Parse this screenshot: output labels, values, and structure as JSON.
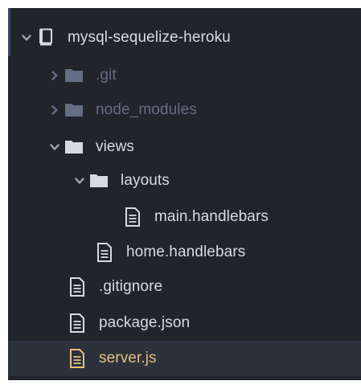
{
  "tree": {
    "root": {
      "label": "mysql-sequelize-heroku",
      "icon": "repo-icon",
      "expanded": true
    },
    "items": [
      {
        "label": ".git",
        "type": "folder",
        "expanded": false,
        "status": "ignored",
        "icon": "folder-icon"
      },
      {
        "label": "node_modules",
        "type": "folder",
        "expanded": false,
        "status": "ignored",
        "icon": "folder-icon"
      },
      {
        "label": "views",
        "type": "folder",
        "expanded": true,
        "status": "normal",
        "icon": "folder-icon"
      },
      {
        "label": "layouts",
        "type": "folder",
        "expanded": true,
        "status": "normal",
        "icon": "folder-icon"
      },
      {
        "label": "main.handlebars",
        "type": "file",
        "status": "normal",
        "icon": "file-text-icon"
      },
      {
        "label": "home.handlebars",
        "type": "file",
        "status": "normal",
        "icon": "file-text-icon"
      },
      {
        "label": ".gitignore",
        "type": "file",
        "status": "normal",
        "icon": "file-text-icon"
      },
      {
        "label": "package.json",
        "type": "file",
        "status": "normal",
        "icon": "file-text-icon"
      },
      {
        "label": "server.js",
        "type": "file",
        "status": "modified",
        "selected": true,
        "icon": "file-text-icon"
      }
    ]
  },
  "colors": {
    "panel_background": "#21252b",
    "selected_background": "#2c313c",
    "text_normal": "#d7dae0",
    "text_ignored": "#636d83",
    "text_modified": "#e5c07b"
  }
}
